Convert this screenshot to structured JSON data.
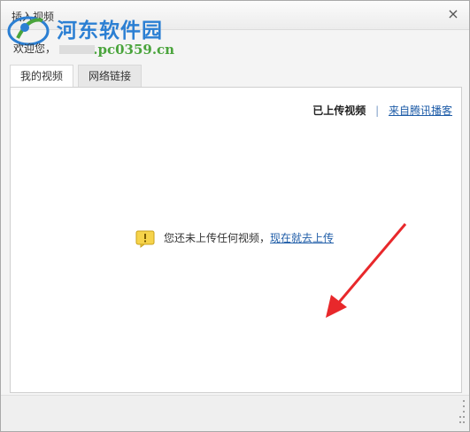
{
  "dialog": {
    "title": "插入视频",
    "close_icon": "close-icon"
  },
  "watermark": {
    "site_name": "河东软件园",
    "url": "www.pc0359.cn"
  },
  "welcome": {
    "text": "欢迎您，"
  },
  "tabs": [
    {
      "label": "我的视频",
      "active": true
    },
    {
      "label": "网络链接",
      "active": false
    }
  ],
  "subnav": {
    "current": "已上传视频",
    "separator": "|",
    "link": "来自腾讯播客"
  },
  "empty_state": {
    "icon": "warning-icon",
    "message": "您还未上传任何视频，",
    "action_link": "现在就去上传"
  },
  "colors": {
    "link": "#1f5da8",
    "arrow": "#e8282b",
    "warning": "#f0c830"
  }
}
